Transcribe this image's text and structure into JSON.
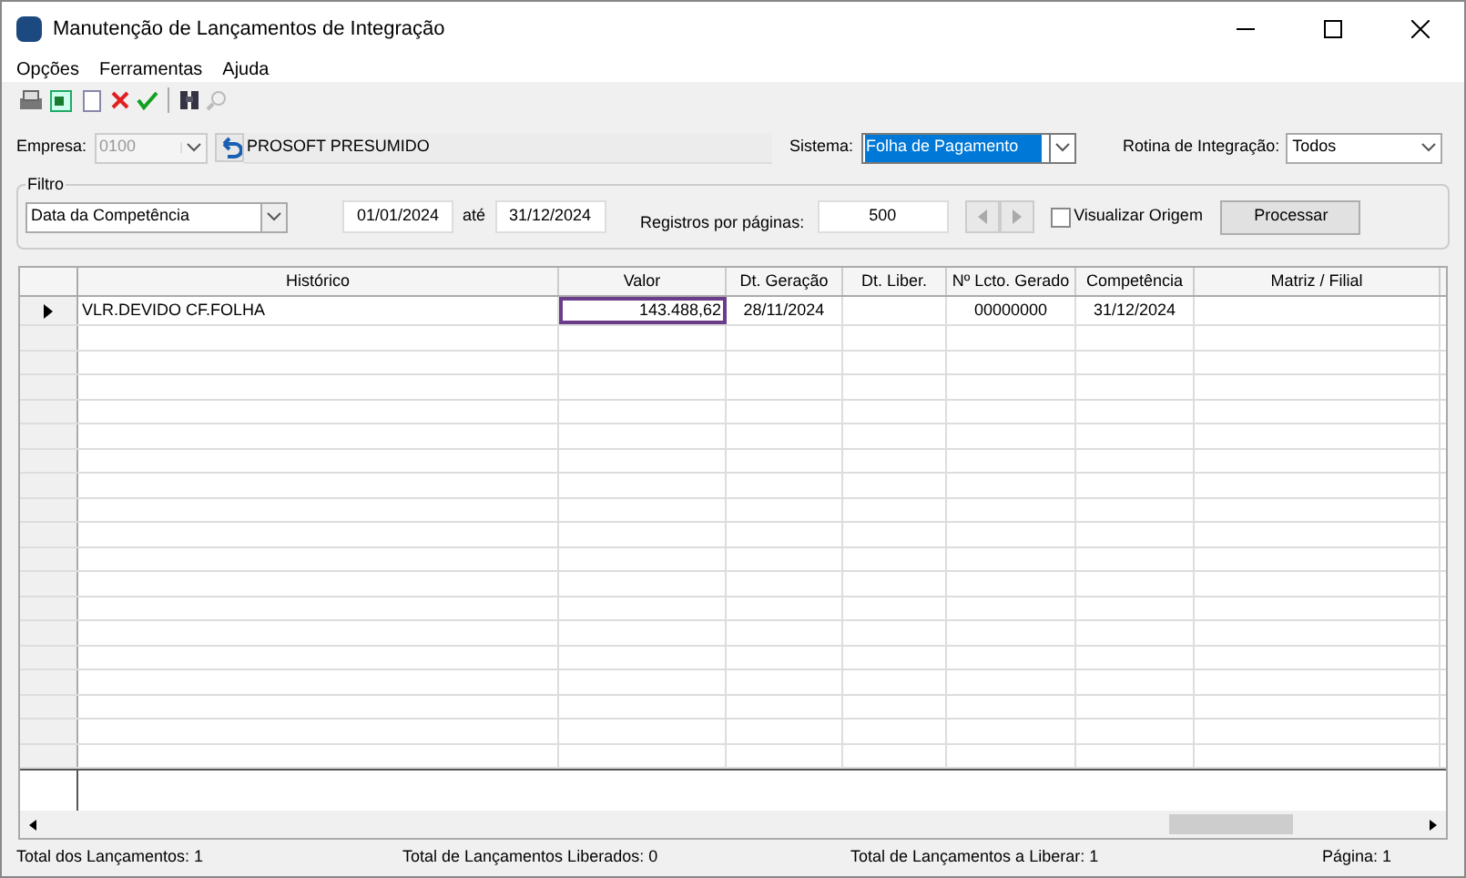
{
  "window": {
    "title": "Manutenção de Lançamentos de Integração"
  },
  "menu": [
    {
      "label": "Opções"
    },
    {
      "label": "Ferramentas"
    },
    {
      "label": "Ajuda"
    }
  ],
  "empresa": {
    "label": "Empresa:",
    "code": "0100",
    "name": "PROSOFT PRESUMIDO"
  },
  "sistema": {
    "label": "Sistema:",
    "value": "Folha de Pagamento"
  },
  "rotina": {
    "label": "Rotina de Integração:",
    "value": "Todos"
  },
  "filtro": {
    "title": "Filtro",
    "type": "Data da Competência",
    "from": "01/01/2024",
    "ate": "até",
    "to": "31/12/2024",
    "registros_label": "Registros por páginas:",
    "registros": "500",
    "visualizar": {
      "label": "Visualizar Origem",
      "checked": false
    },
    "processar": "Processar"
  },
  "table": {
    "columns": [
      "Histórico",
      "Valor",
      "Dt. Geração",
      "Dt. Liber.",
      "Nº Lcto. Gerado",
      "Competência",
      "Matriz / Filial"
    ],
    "rows": [
      {
        "selected": true,
        "cells": [
          "VLR.DEVIDO CF.FOLHA",
          "143.488,62",
          "28/11/2024",
          "",
          "00000000",
          "31/12/2024",
          ""
        ]
      }
    ]
  },
  "status_bar": [
    "Total dos Lançamentos: 1",
    "Total de Lançamentos Liberados: 0",
    "Total de Lançamentos a Liberar: 1",
    "Página: 1"
  ]
}
